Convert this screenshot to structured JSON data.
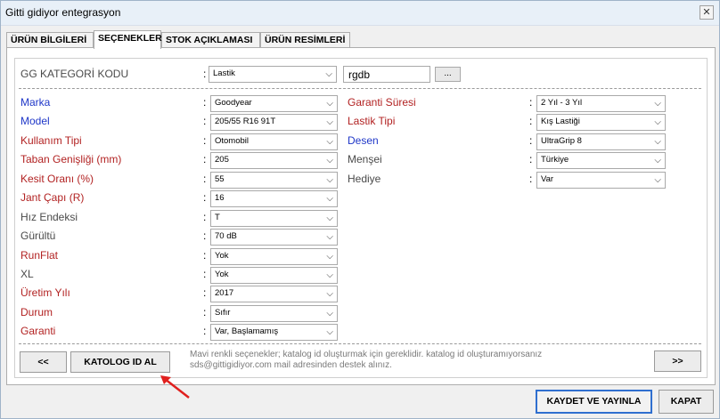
{
  "window": {
    "title": "Gitti gidiyor entegrasyon",
    "close_label": "✕"
  },
  "tabs": [
    {
      "label": "ÜRÜN BİLGİLERİ"
    },
    {
      "label": "SEÇENEKLER"
    },
    {
      "label": "STOK AÇIKLAMASI"
    },
    {
      "label": "ÜRÜN RESİMLERİ"
    }
  ],
  "category": {
    "label": "GG KATEGORİ KODU",
    "select_value": "Lastik",
    "code_value": "rgdb",
    "browse_label": "..."
  },
  "colon": ":",
  "left_fields": [
    {
      "label": "Marka",
      "value": "Goodyear"
    },
    {
      "label": "Model",
      "value": "205/55 R16 91T"
    },
    {
      "label": "Kullanım Tipi",
      "value": "Otomobil"
    },
    {
      "label": "Taban Genişliği (mm)",
      "value": "205"
    },
    {
      "label": "Kesit Oranı (%)",
      "value": "55"
    },
    {
      "label": "Jant Çapı (R)",
      "value": "16"
    },
    {
      "label": "Hız Endeksi",
      "value": "T"
    },
    {
      "label": "Gürültü",
      "value": "70 dB"
    },
    {
      "label": "RunFlat",
      "value": "Yok"
    },
    {
      "label": "XL",
      "value": "Yok"
    },
    {
      "label": "Üretim Yılı",
      "value": "2017"
    },
    {
      "label": "Durum",
      "value": "Sıfır"
    },
    {
      "label": "Garanti",
      "value": "Var, Başlamamış"
    }
  ],
  "right_fields": [
    {
      "label": "Garanti Süresi",
      "value": "2 Yıl - 3 Yıl"
    },
    {
      "label": "Lastik Tipi",
      "value": "Kış Lastiği"
    },
    {
      "label": "Desen",
      "value": "UltraGrip 8"
    },
    {
      "label": "Menşei",
      "value": "Türkiye"
    },
    {
      "label": "Hediye",
      "value": "Var"
    }
  ],
  "colors": {
    "required": "#b22222",
    "catalog": "#1f37c8",
    "optional": "#4a4a4a",
    "annotation": "#e0201e"
  },
  "nav": {
    "prev_label": "<<",
    "catalog_label": "KATOLOG ID AL",
    "next_label": ">>",
    "info_line1": "Mavi renkli seçenekler; katalog id oluşturmak için gereklidir. katalog id oluşturamıyorsanız",
    "info_line2": "sds@gittigidiyor.com mail adresinden destek alınız."
  },
  "footer": {
    "save_label": "KAYDET VE YAYINLA",
    "close_label": "KAPAT"
  }
}
